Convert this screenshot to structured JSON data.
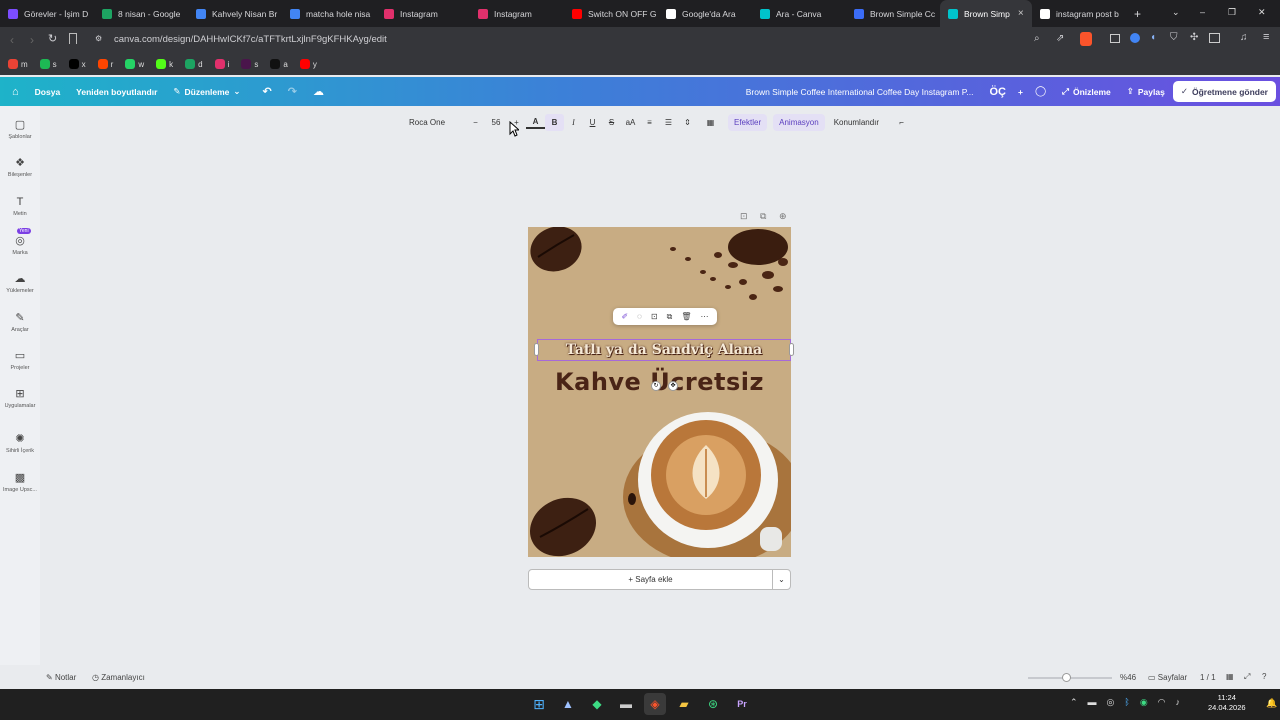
{
  "browser": {
    "tabs": [
      {
        "label": "Görevler - İşim D",
        "color": "#7c4dff"
      },
      {
        "label": "8 nisan - Google",
        "color": "#1da462"
      },
      {
        "label": "Kahvely Nisan Br",
        "color": "#4285f4"
      },
      {
        "label": "matcha hole nisa",
        "color": "#4285f4"
      },
      {
        "label": "Instagram",
        "color": "#e1306c"
      },
      {
        "label": "Instagram",
        "color": "#e1306c"
      },
      {
        "label": "Switch ON OFF G",
        "color": "#ff0000"
      },
      {
        "label": "Google'da Ara",
        "color": "#ffffff"
      },
      {
        "label": "Ara - Canva",
        "color": "#00c4cc"
      },
      {
        "label": "Brown Simple Cc",
        "color": "#3b6cf6"
      },
      {
        "label": "Brown Simp",
        "color": "#00c4cc"
      },
      {
        "label": "instagram post b",
        "color": "#ffffff"
      }
    ],
    "url": "canva.com/design/DAHHwICKf7c/aTFTkrtLxjlnF9gKFHKAyg/edit",
    "bookmarks": [
      {
        "label": "m",
        "color": "#ea4335"
      },
      {
        "label": "s",
        "color": "#1db954"
      },
      {
        "label": "x",
        "color": "#000000"
      },
      {
        "label": "r",
        "color": "#ff4500"
      },
      {
        "label": "w",
        "color": "#25d366"
      },
      {
        "label": "k",
        "color": "#53fc18"
      },
      {
        "label": "d",
        "color": "#1da462"
      },
      {
        "label": "i",
        "color": "#e1306c"
      },
      {
        "label": "s",
        "color": "#4a154b"
      },
      {
        "label": "a",
        "color": "#111111"
      },
      {
        "label": "y",
        "color": "#ff0000"
      }
    ]
  },
  "header": {
    "home_icon": "home-icon",
    "file": "Dosya",
    "resize": "Yeniden boyutlandır",
    "edit": "Düzenleme",
    "title": "Brown Simple Coffee International Coffee Day Instagram P...",
    "avatar": "ÖÇ",
    "preview": "Önizleme",
    "share": "Paylaş",
    "send_teacher": "Öğretmene gönder"
  },
  "sidebar": [
    {
      "label": "Şablonlar",
      "icon": "template-icon"
    },
    {
      "label": "Bileşenler",
      "icon": "elements-icon"
    },
    {
      "label": "Metin",
      "icon": "text-icon"
    },
    {
      "label": "Marka",
      "icon": "brand-icon",
      "badge": "Yeni"
    },
    {
      "label": "Yüklemeler",
      "icon": "upload-icon"
    },
    {
      "label": "Araçlar",
      "icon": "draw-icon"
    },
    {
      "label": "Projeler",
      "icon": "folder-icon"
    },
    {
      "label": "Uygulamalar",
      "icon": "apps-icon"
    },
    {
      "label": "Sihirli İçerik",
      "icon": "magic-icon"
    },
    {
      "label": "Image Upsc...",
      "icon": "image-upscaler-icon"
    }
  ],
  "toolbar": {
    "font": "Roca One",
    "font_size": "56",
    "effects": "Efektler",
    "animation": "Animasyon",
    "position": "Konumlandır"
  },
  "design": {
    "line1": "Tatlı ya da Sandviç Alana",
    "line2": "Kahve Ücretsiz",
    "background": "#c8ac83",
    "text_color": "#4a2416"
  },
  "canvas": {
    "add_page": "+ Sayfa ekle"
  },
  "bottom": {
    "notes": "Notlar",
    "timer": "Zamanlayıcı",
    "zoom": "%46",
    "pages_label": "Sayfalar",
    "page_count": "1 / 1",
    "zoom_level": 0.46
  },
  "taskbar": {
    "time": "11:24",
    "date": "24.04.2026"
  }
}
